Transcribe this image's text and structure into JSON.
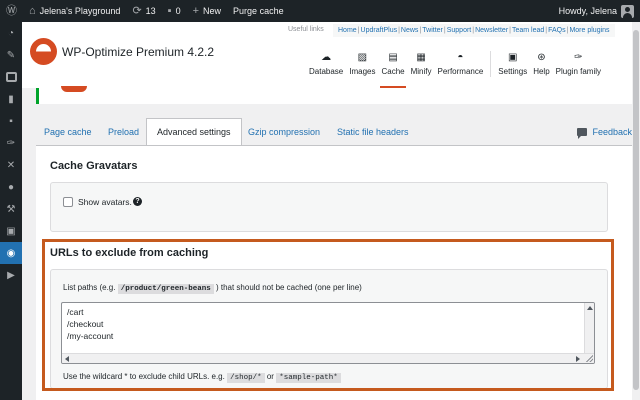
{
  "adminbar": {
    "site_name": "Jelena's Playground",
    "updates_count": "13",
    "comments_count": "0",
    "new_label": "New",
    "purge_label": "Purge cache",
    "howdy": "Howdy, Jelena"
  },
  "header": {
    "plugin_title": "WP-Optimize Premium 4.2.2",
    "useful_links_label": "Useful links",
    "links": [
      "Home",
      "UpdraftPlus",
      "News",
      "Twitter",
      "Support",
      "Newsletter",
      "Team lead",
      "FAQs",
      "More plugins"
    ],
    "nav": [
      {
        "label": "Database",
        "icon": "cloud-icon"
      },
      {
        "label": "Images",
        "icon": "image-icon"
      },
      {
        "label": "Cache",
        "icon": "archive-icon",
        "active": true
      },
      {
        "label": "Minify",
        "icon": "grid-icon"
      },
      {
        "label": "Performance",
        "icon": "gauge-icon"
      },
      {
        "label": "Settings",
        "icon": "settings-icon"
      },
      {
        "label": "Help",
        "icon": "lifebuoy-icon"
      },
      {
        "label": "Plugin family",
        "icon": "plugin-icon"
      }
    ]
  },
  "tabs": {
    "items": [
      "Page cache",
      "Preload",
      "Advanced settings",
      "Gzip compression",
      "Static file headers"
    ],
    "active": "Advanced settings",
    "feedback_label": "Feedback"
  },
  "gravatars": {
    "title": "Cache Gravatars",
    "checkbox_label": "Show avatars.",
    "checked": false
  },
  "exclude": {
    "title": "URLs to exclude from caching",
    "desc_before": "List paths (e.g.",
    "desc_code": "/product/green-beans",
    "desc_after": ") that should not be cached (one per line)",
    "urls": [
      "/cart",
      "/checkout",
      "/my-account"
    ],
    "hint_before": "Use the wildcard * to exclude child URLs. e.g.",
    "hint_code1": "/shop/*",
    "hint_or": "or",
    "hint_code2": "*sample-path*"
  },
  "colors": {
    "accent": "#d54b22",
    "highlight_border": "#c55a1e",
    "link": "#2271b1",
    "adminbar_bg": "#1d2327",
    "menu_current": "#2271b1"
  }
}
